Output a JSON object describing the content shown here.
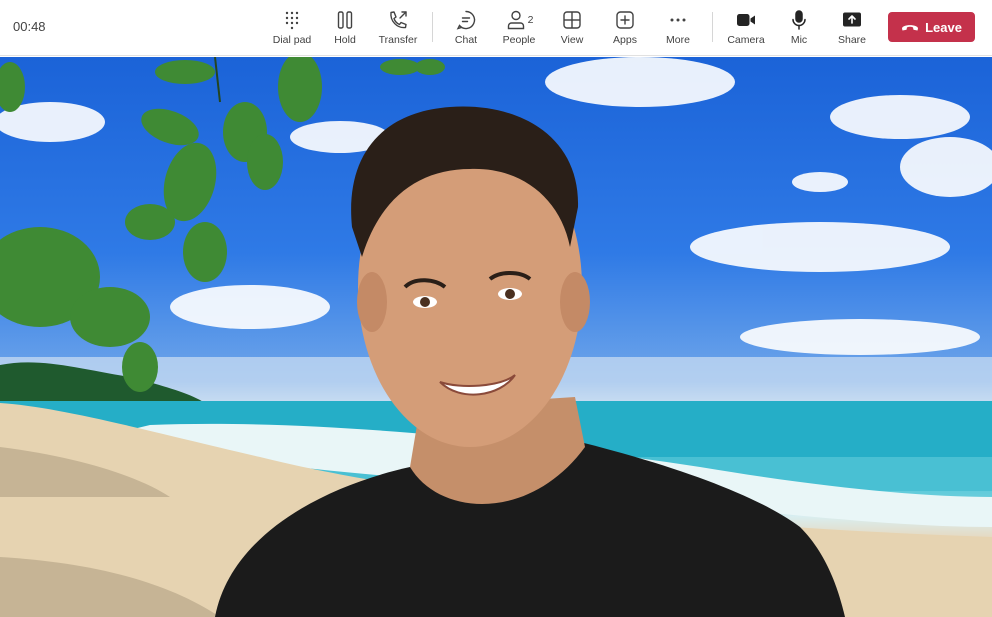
{
  "call": {
    "timer": "00:48"
  },
  "toolbar": {
    "dial_pad": "Dial pad",
    "hold": "Hold",
    "transfer": "Transfer",
    "chat": "Chat",
    "people": "People",
    "people_count": "2",
    "view": "View",
    "apps": "Apps",
    "more": "More",
    "camera": "Camera",
    "mic": "Mic",
    "share": "Share",
    "leave": "Leave"
  },
  "colors": {
    "leave": "#c4314b",
    "icon": "#424242"
  }
}
